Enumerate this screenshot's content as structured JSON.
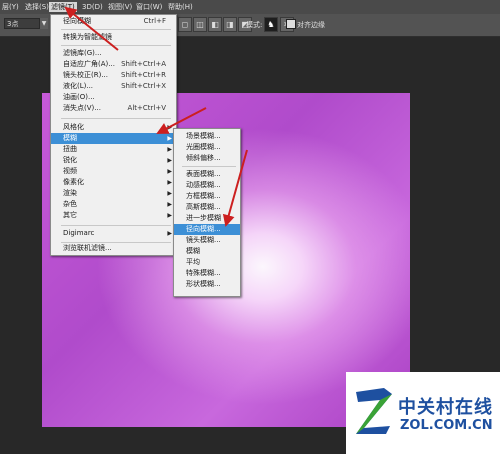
{
  "menubar": {
    "items": [
      "层(Y)",
      "选择(S)",
      "滤镜(T)",
      "3D(D)",
      "视图(V)",
      "窗口(W)",
      "帮助(H)"
    ],
    "active": "滤镜(T)"
  },
  "options": {
    "size_value": "3点",
    "label_mode": "模式:",
    "label_antialias": "对齐边缘"
  },
  "filter_menu": {
    "top": [
      {
        "label": "径向模糊",
        "shortcut": "Ctrl+F"
      }
    ],
    "convert": {
      "label": "转换为智能滤镜"
    },
    "group2": [
      {
        "label": "滤镜库(G)...",
        "shortcut": ""
      },
      {
        "label": "自适应广角(A)...",
        "shortcut": "Shift+Ctrl+A"
      },
      {
        "label": "镜头校正(R)...",
        "shortcut": "Shift+Ctrl+R"
      },
      {
        "label": "液化(L)...",
        "shortcut": "Shift+Ctrl+X"
      },
      {
        "label": "油画(O)...",
        "shortcut": ""
      },
      {
        "label": "消失点(V)...",
        "shortcut": "Alt+Ctrl+V"
      }
    ],
    "group3": [
      "风格化",
      "模糊",
      "扭曲",
      "锐化",
      "视频",
      "像素化",
      "渲染",
      "杂色",
      "其它"
    ],
    "highlighted": "模糊",
    "digimarc": "Digimarc",
    "browse": "浏览联机滤镜..."
  },
  "blur_submenu": {
    "group1": [
      "场景模糊...",
      "光圈模糊...",
      "倾斜偏移..."
    ],
    "group2": [
      "表面模糊...",
      "动感模糊...",
      "方框模糊...",
      "高斯模糊...",
      "进一步模糊",
      "径向模糊...",
      "镜头模糊...",
      "模糊",
      "平均",
      "特殊模糊...",
      "形状模糊..."
    ],
    "highlighted": "径向模糊..."
  },
  "watermark": {
    "cn": "中关村在线",
    "en": "ZOL.COM.CN"
  },
  "colors": {
    "accent_highlight": "#3c8fd6",
    "annotation_arrow": "#cc1f1f",
    "logo_blue": "#1e50a0",
    "logo_green": "#3aa336"
  }
}
